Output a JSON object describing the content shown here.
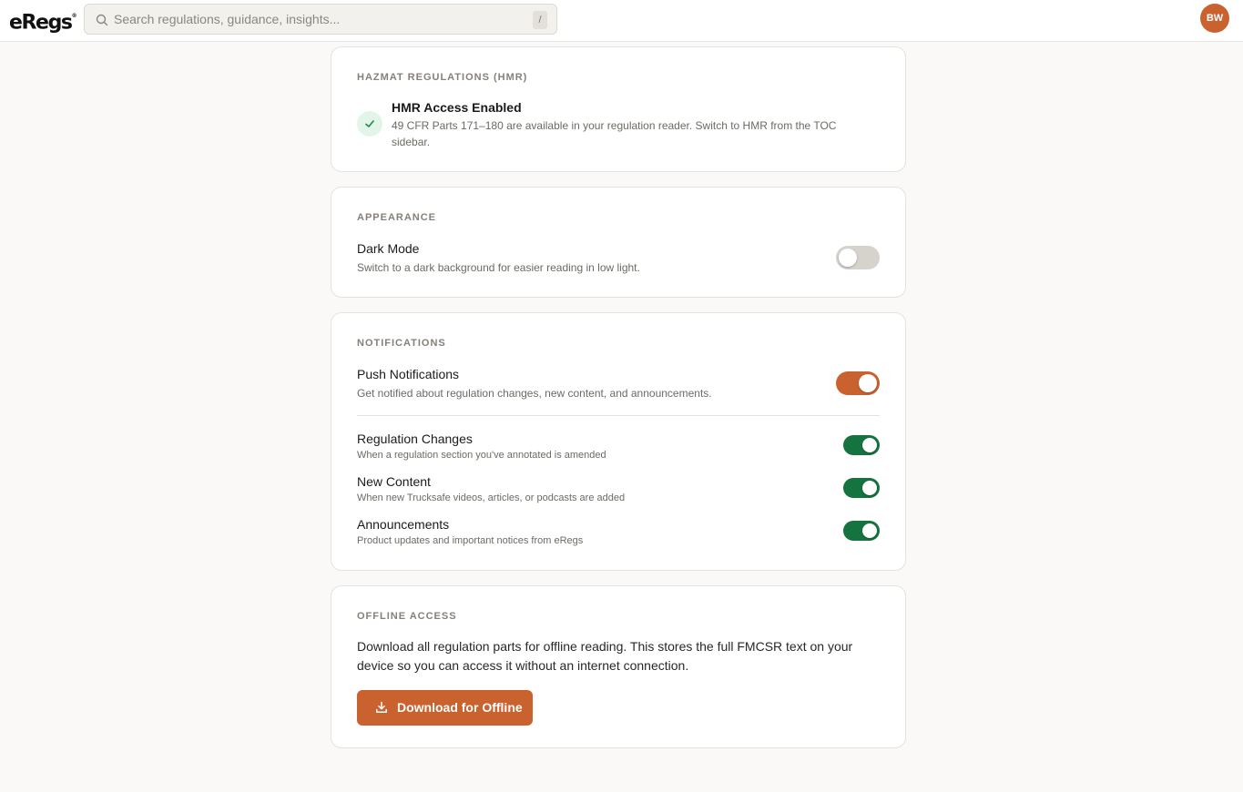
{
  "header": {
    "logo_text": "eRegs",
    "search_placeholder": "Search regulations, guidance, insights...",
    "search_shortcut": "/",
    "avatar_initials": "BW"
  },
  "hmr": {
    "title": "HAZMAT REGULATIONS (HMR)",
    "status_title": "HMR Access Enabled",
    "status_desc": "49 CFR Parts 171–180 are available in your regulation reader. Switch to HMR from the TOC sidebar."
  },
  "appearance": {
    "title": "APPEARANCE",
    "dark_mode_label": "Dark Mode",
    "dark_mode_desc": "Switch to a dark background for easier reading in low light.",
    "dark_mode_enabled": false
  },
  "notifications": {
    "title": "NOTIFICATIONS",
    "push_label": "Push Notifications",
    "push_desc": "Get notified about regulation changes, new content, and announcements.",
    "push_enabled": true,
    "items": [
      {
        "label": "Regulation Changes",
        "desc": "When a regulation section you've annotated is amended",
        "enabled": true
      },
      {
        "label": "New Content",
        "desc": "When new Trucksafe videos, articles, or podcasts are added",
        "enabled": true
      },
      {
        "label": "Announcements",
        "desc": "Product updates and important notices from eRegs",
        "enabled": true
      }
    ]
  },
  "offline": {
    "title": "OFFLINE ACCESS",
    "desc": "Download all regulation parts for offline reading. This stores the full FMCSR text on your device so you can access it without an internet connection.",
    "button_label": "Download for Offline"
  },
  "colors": {
    "accent": "#c9622f",
    "toggle_green": "#15733f",
    "toggle_off": "#d6d2cc",
    "check_green": "#1f8a4c"
  }
}
